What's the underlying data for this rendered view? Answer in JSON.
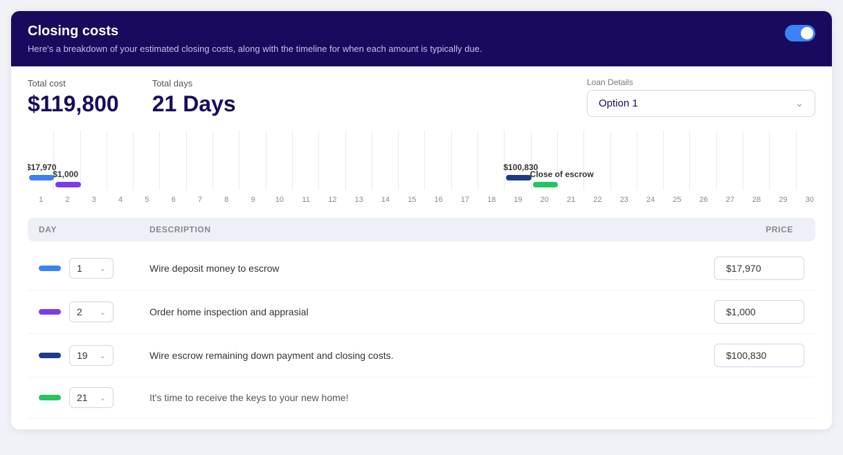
{
  "header": {
    "title": "Closing costs",
    "subtitle": "Here's a breakdown of your estimated closing costs, along with the timeline for when each amount is typically due.",
    "toggle_label": "toggle"
  },
  "summary": {
    "total_cost_label": "Total cost",
    "total_cost_value": "$119,800",
    "total_days_label": "Total days",
    "total_days_value": "21 Days",
    "loan_details_label": "Loan Details",
    "loan_option": "Option 1",
    "chevron": "⌄"
  },
  "chart": {
    "bars": [
      {
        "id": "bar1",
        "color": "blue",
        "label": "$17,970",
        "day_start": 1,
        "day_end": 2
      },
      {
        "id": "bar2",
        "color": "purple",
        "label": "$1,000",
        "day_start": 2,
        "day_end": 3
      },
      {
        "id": "bar3",
        "color": "dark-blue",
        "label": "$100,830",
        "day_start": 19,
        "day_end": 20
      },
      {
        "id": "bar4",
        "color": "green",
        "label": "Close of escrow",
        "day_start": 20,
        "day_end": 21
      }
    ],
    "axis_start": 1,
    "axis_end": 47
  },
  "table": {
    "headers": [
      "DAY",
      "DESCRIPTION",
      "PRICE"
    ],
    "rows": [
      {
        "color": "blue",
        "day": "1",
        "description": "Wire deposit money to escrow",
        "price": "$17,970"
      },
      {
        "color": "purple",
        "day": "2",
        "description": "Order home inspection and apprasial",
        "price": "$1,000"
      },
      {
        "color": "dark-blue",
        "day": "19",
        "description": "Wire escrow remaining down payment and closing costs.",
        "price": "$100,830"
      },
      {
        "color": "green",
        "day": "21",
        "description": "It's time to receive the keys to your new home!",
        "price": ""
      }
    ]
  }
}
